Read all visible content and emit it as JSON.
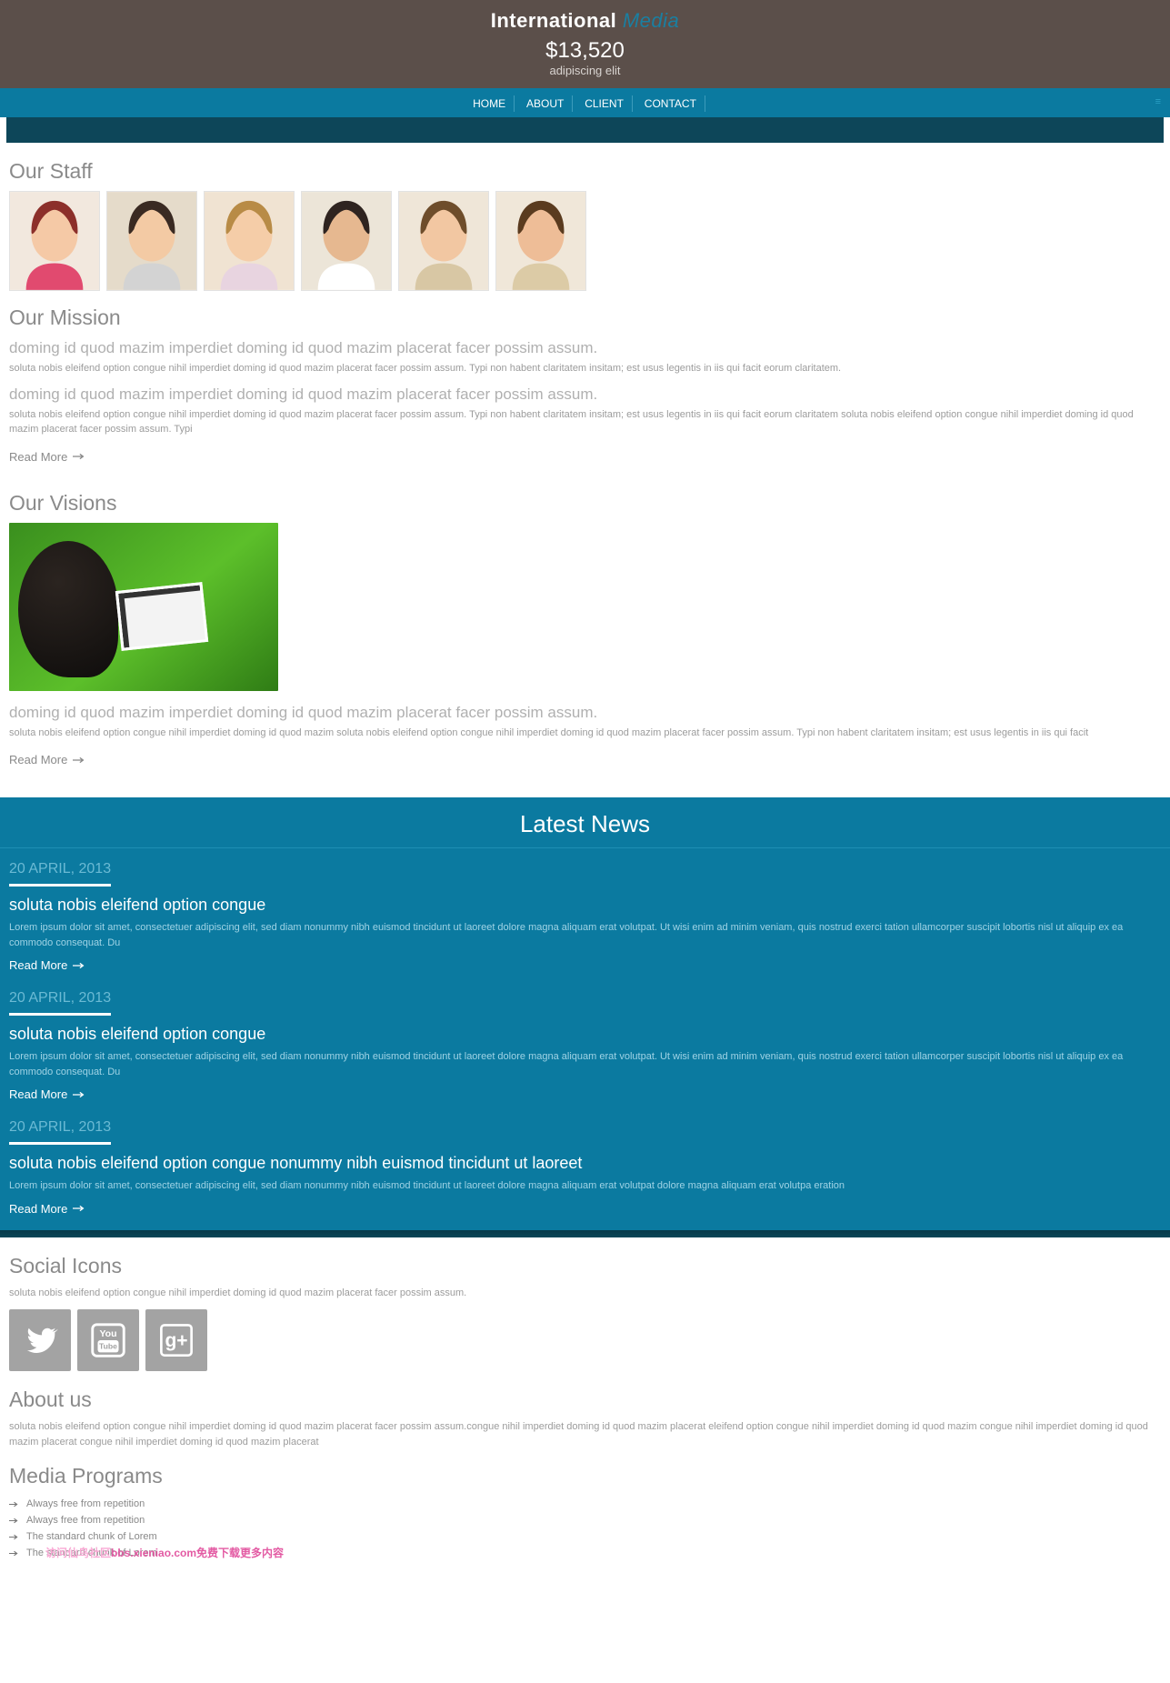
{
  "header": {
    "logo_first": "International",
    "logo_second": " Media",
    "amount": "$13,520",
    "tagline": "adipiscing elit",
    "nav": [
      "HOME",
      "ABOUT",
      "CLIENT",
      "CONTACT"
    ]
  },
  "staff": {
    "heading": "Our Staff",
    "thumbs": [
      {
        "hair": "#8c2f2a",
        "skin": "#f5c9a6",
        "bg": "#f2e8de",
        "acc": "#e14a6f"
      },
      {
        "hair": "#3a2a22",
        "skin": "#f3caa4",
        "bg": "#e5dbca",
        "acc": "#d3d3d3"
      },
      {
        "hair": "#b88b46",
        "skin": "#f5cda8",
        "bg": "#f0e3d2",
        "acc": "#e8d4e0"
      },
      {
        "hair": "#2f2420",
        "skin": "#e6b890",
        "bg": "#ece5d8",
        "acc": "#ffffff"
      },
      {
        "hair": "#6e4d2b",
        "skin": "#f2c7a2",
        "bg": "#efe6d8",
        "acc": "#d8c7a4"
      },
      {
        "hair": "#5a3b1f",
        "skin": "#eebd97",
        "bg": "#f0e7d9",
        "acc": "#dccba6"
      }
    ]
  },
  "mission": {
    "heading": "Our Mission",
    "sub1": "doming id quod mazim imperdiet doming id quod mazim placerat facer possim assum.",
    "p1": "soluta nobis eleifend option congue nihil imperdiet doming id quod mazim placerat facer possim assum. Typi non habent claritatem insitam; est usus legentis in iis qui facit eorum claritatem.",
    "sub2": "doming id quod mazim imperdiet doming id quod mazim placerat facer possim assum.",
    "p2": "soluta nobis eleifend option congue nihil imperdiet doming id quod mazim placerat facer possim assum. Typi non habent claritatem insitam; est usus legentis in iis qui facit eorum claritatem soluta nobis eleifend option congue nihil imperdiet doming id quod mazim placerat facer possim assum. Typi",
    "read": "Read More"
  },
  "visions": {
    "heading": "Our Visions",
    "sub": "doming id quod mazim imperdiet doming id quod mazim placerat facer possim assum.",
    "p": "soluta nobis eleifend option congue nihil imperdiet doming id quod mazim soluta nobis eleifend option congue nihil imperdiet doming id quod mazim placerat facer possim assum. Typi non habent claritatem insitam; est usus legentis in iis qui facit",
    "read": "Read More"
  },
  "latest": {
    "title": "Latest News",
    "items": [
      {
        "date": "20 APRIL, 2013",
        "head": "soluta nobis eleifend option congue",
        "text": "Lorem ipsum dolor sit amet, consectetuer adipiscing elit, sed diam nonummy nibh euismod tincidunt ut laoreet dolore magna aliquam erat volutpat. Ut wisi enim ad minim veniam, quis nostrud exerci tation ullamcorper suscipit lobortis nisl ut aliquip ex ea commodo consequat. Du",
        "read": "Read More"
      },
      {
        "date": "20 APRIL, 2013",
        "head": "soluta nobis eleifend option congue",
        "text": "Lorem ipsum dolor sit amet, consectetuer adipiscing elit, sed diam nonummy nibh euismod tincidunt ut laoreet dolore magna aliquam erat volutpat. Ut wisi enim ad minim veniam, quis nostrud exerci tation ullamcorper suscipit lobortis nisl ut aliquip ex ea commodo consequat. Du",
        "read": "Read More"
      },
      {
        "date": "20 APRIL, 2013",
        "head": "soluta nobis eleifend option congue nonummy nibh euismod tincidunt ut laoreet",
        "text": "Lorem ipsum dolor sit amet, consectetuer adipiscing elit, sed diam nonummy nibh euismod tincidunt ut laoreet dolore magna aliquam erat volutpat dolore magna aliquam erat volutpa eration",
        "read": "Read More"
      }
    ]
  },
  "social": {
    "heading": "Social Icons",
    "p": "soluta nobis eleifend option congue nihil imperdiet doming id quod mazim placerat facer possim assum."
  },
  "about": {
    "heading": "About us",
    "p": "soluta nobis eleifend option congue nihil imperdiet doming id quod mazim placerat facer possim assum.congue nihil imperdiet doming id quod mazim placerat eleifend option congue nihil imperdiet doming id quod mazim congue nihil imperdiet doming id quod mazim placerat congue nihil imperdiet doming id quod mazim placerat"
  },
  "programs": {
    "heading": "Media Programs",
    "items": [
      "Always free from repetition",
      "Always free from repetition",
      "The standard chunk of Lorem",
      "The standard chunk of Lorem"
    ]
  },
  "watermark": {
    "light": "访问仙鸟社区",
    "strong": "bbs.xieniao.com免费下载更多内容"
  }
}
